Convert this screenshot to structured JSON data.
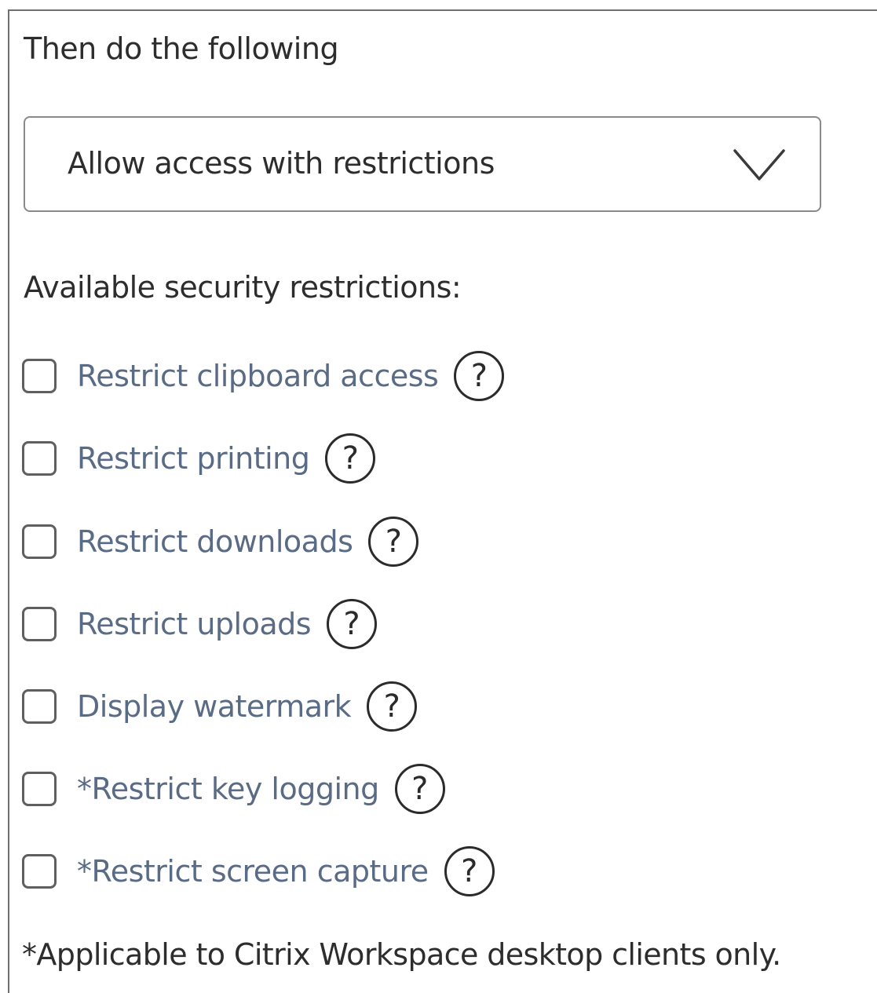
{
  "heading": "Then do the following",
  "action_select": {
    "selected": "Allow access with restrictions",
    "icon": "chevron-down-icon"
  },
  "restrictions_label": "Available security restrictions:",
  "restrictions": [
    {
      "label": "Restrict clipboard access",
      "checked": false,
      "help": "?"
    },
    {
      "label": "Restrict printing",
      "checked": false,
      "help": "?"
    },
    {
      "label": "Restrict downloads",
      "checked": false,
      "help": "?"
    },
    {
      "label": "Restrict uploads",
      "checked": false,
      "help": "?"
    },
    {
      "label": "Display watermark",
      "checked": false,
      "help": "?"
    },
    {
      "label": "*Restrict key logging",
      "checked": false,
      "help": "?"
    },
    {
      "label": "*Restrict screen capture",
      "checked": false,
      "help": "?"
    }
  ],
  "footnote": "*Applicable to Citrix Workspace desktop clients only.",
  "colors": {
    "option_text": "#5a6b85",
    "text": "#2d2d2d",
    "border": "#8a8a8a"
  }
}
